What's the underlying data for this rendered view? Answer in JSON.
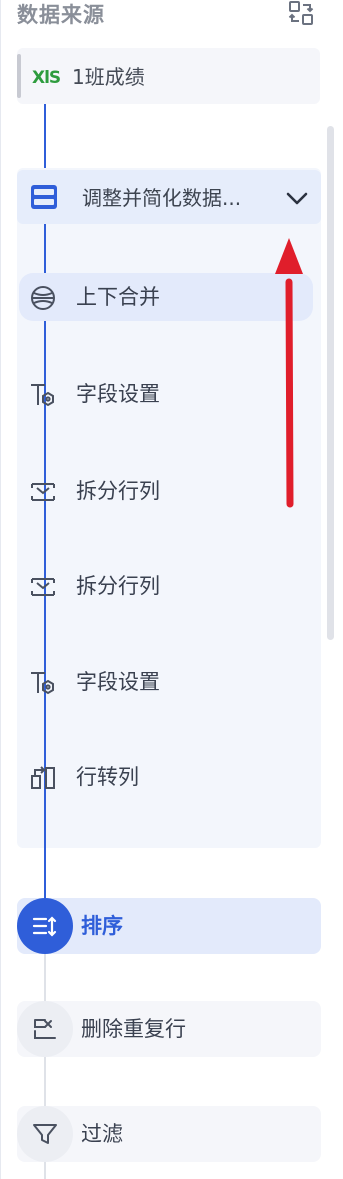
{
  "header": {
    "title": "数据来源",
    "switch_icon": "swap-layout-icon"
  },
  "source": {
    "icon": "xls-icon",
    "icon_text": "XlS",
    "label": "1班成绩"
  },
  "group": {
    "icon": "table-merge-icon",
    "label": "调整并简化数据...",
    "chevron": "chevron-down-icon"
  },
  "steps": [
    {
      "label": "上下合并",
      "icon": "vertical-merge-icon"
    },
    {
      "label": "字段设置",
      "icon": "field-settings-icon"
    },
    {
      "label": "拆分行列",
      "icon": "split-icon"
    },
    {
      "label": "拆分行列",
      "icon": "split-icon"
    },
    {
      "label": "字段设置",
      "icon": "field-settings-icon"
    },
    {
      "label": "行转列",
      "icon": "row-to-column-icon"
    }
  ],
  "main_steps": [
    {
      "label": "排序",
      "icon": "sort-icon",
      "active": true
    },
    {
      "label": "删除重复行",
      "icon": "dedupe-icon",
      "active": false
    },
    {
      "label": "过滤",
      "icon": "filter-icon",
      "active": false
    }
  ],
  "colors": {
    "accent": "#2f5ed9",
    "annotation": "#e01e2b",
    "xls_green": "#2e9c3e"
  }
}
